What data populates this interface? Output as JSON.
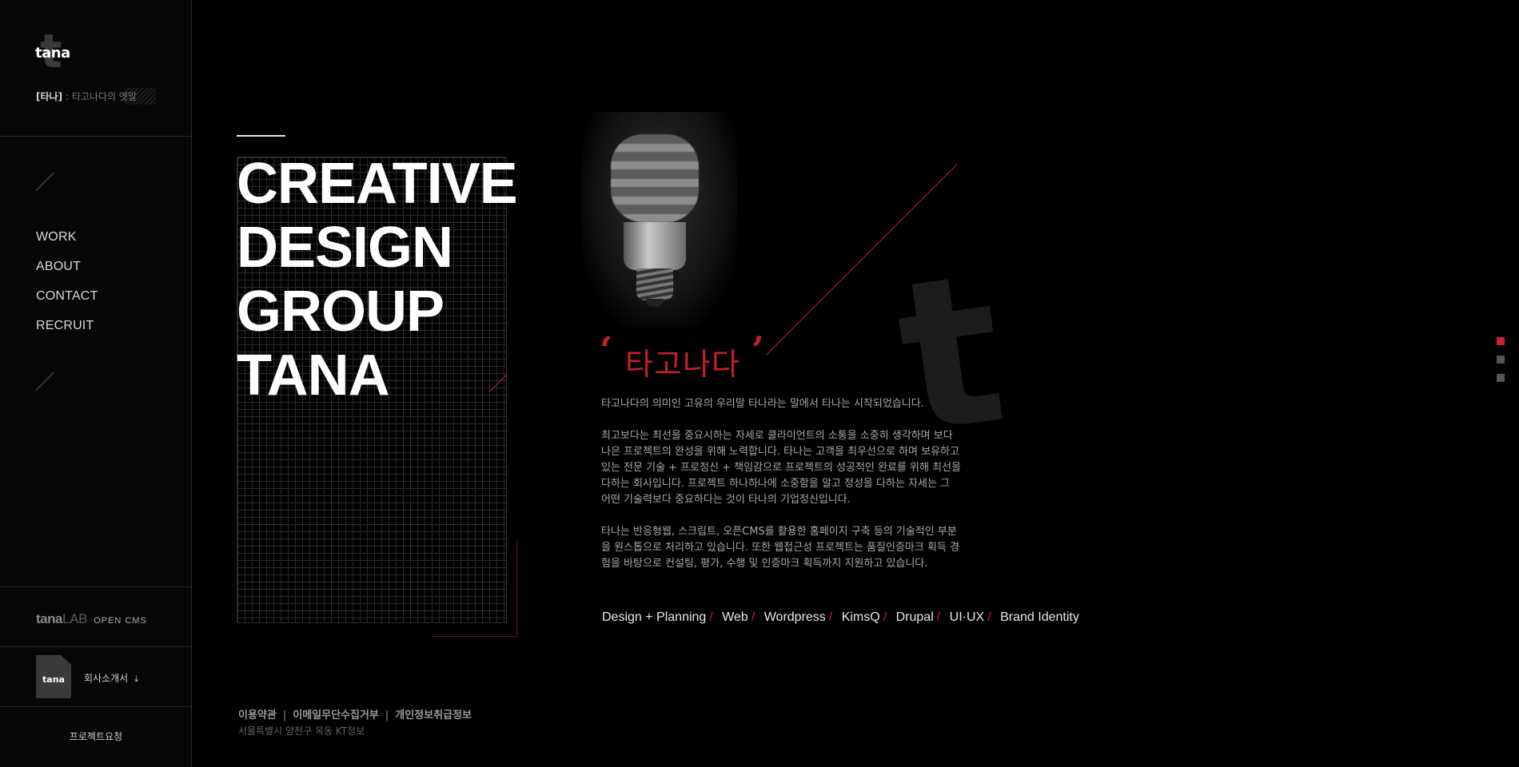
{
  "brand": {
    "logo_text": "tana",
    "logo_mark": "t",
    "tag_bracket": "[타나]",
    "tag_text": ": 타고나다의 옛말"
  },
  "nav": {
    "items": [
      {
        "label": "WORK"
      },
      {
        "label": "ABOUT"
      },
      {
        "label": "CONTACT"
      },
      {
        "label": "RECRUIT"
      }
    ]
  },
  "lab": {
    "name_bold": "tana",
    "name_light": "LAB",
    "suffix": "OPEN CMS"
  },
  "brochure": {
    "icon_text": "tana",
    "label": "회사소개서"
  },
  "request": {
    "label": "프로젝트요청"
  },
  "hero": {
    "lines": [
      "CREATIVE",
      "DESIGN",
      "GROUP",
      "TANA"
    ]
  },
  "quote": {
    "open": "‘",
    "title": "타고나다",
    "close": "’"
  },
  "description": {
    "p1": "타고나다의 의미인 고유의 우리말 타나라는 말에서 타나는 시작되었습니다.",
    "p2": "최고보다는 최선을 중요시하는 자세로 클라이언트의 소통을 소중히 생각하며 보다 나은 프로젝트의 완성을 위해 노력합니다. 타나는 고객을 최우선으로 하며 보유하고 있는 전문 기술 + 프로정신 + 책임감으로 프로젝트의 성공적인 완료를 위해 최선을 다하는 회사입니다. 프로젝트 하나하나에 소중함을 알고 정성을 다하는 자세는 그 어떤 기술력보다 중요하다는 것이 타나의 기업정신입니다.",
    "p3": "타나는 반응형웹, 스크립트, 오픈CMS를 활용한 홈페이지 구축 등의 기술적인 부분을 원스톱으로 처리하고 있습니다. 또한 웹접근성 프로젝트는 품질인증마크 획득 경험을 바탕으로 컨설팅, 평가, 수행 및 인증마크 획득까지 지원하고 있습니다."
  },
  "services": [
    "Design + Planning",
    "Web",
    "Wordpress",
    "KimsQ",
    "Drupal",
    "UI·UX",
    "Brand Identity"
  ],
  "footer": {
    "links": [
      "이용약관",
      "이메일무단수집거부",
      "개인정보취급정보"
    ],
    "separator": "|",
    "address": "서울특별시 양천구 목동 KT정보"
  },
  "pager": {
    "count": 3,
    "active_index": 0
  },
  "colors": {
    "accent": "#c0202a",
    "background": "#000000",
    "sidebar": "#070707"
  }
}
